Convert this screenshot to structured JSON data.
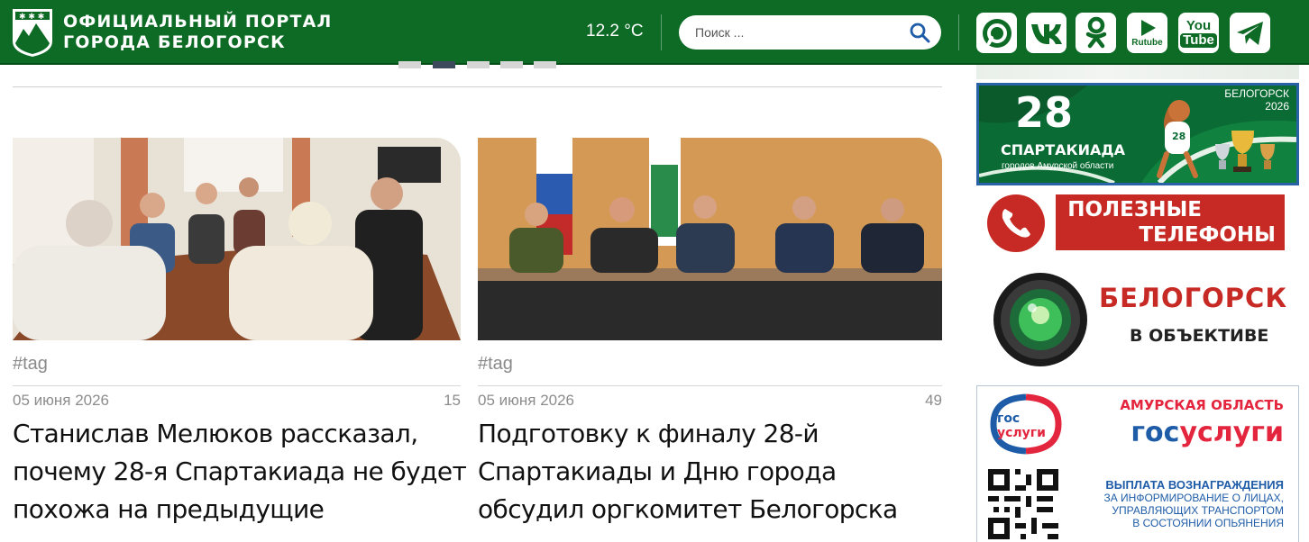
{
  "header": {
    "site_title_line1": "ОФИЦИАЛЬНЫЙ ПОРТАЛ",
    "site_title_line2": "ГОРОДА БЕЛОГОРСК",
    "temperature": "12.2 °C",
    "search_placeholder": "Поиск ...",
    "social": [
      {
        "name": "max",
        "icon": "max-icon"
      },
      {
        "name": "vk",
        "label": "VK",
        "icon": "vk-icon"
      },
      {
        "name": "odnoklassniki",
        "icon": "ok-icon"
      },
      {
        "name": "rutube",
        "label": "Rutube",
        "icon": "rutube-icon"
      },
      {
        "name": "youtube",
        "label_top": "You",
        "label_bottom": "Tube",
        "icon": "youtube-icon"
      },
      {
        "name": "telegram",
        "icon": "telegram-icon"
      }
    ]
  },
  "slider": {
    "dots": 5,
    "active_index": 1
  },
  "news": [
    {
      "tag": "#tag",
      "date": "05 июня 2026",
      "views": "15",
      "title": "Станислав Мелюков рассказал, почему 28-я Спартакиада не будет похожа на предыдущие"
    },
    {
      "tag": "#tag",
      "date": "05 июня 2026",
      "views": "49",
      "title": "Подготовку к финалу 28-й Спартакиады и Дню города обсудил оргкомитет Белогорска"
    }
  ],
  "sidebar": {
    "spartakiad": {
      "number": "28",
      "name": "СПАРТАКИАДА",
      "subtitle": "городов Амурской области",
      "city": "БЕЛОГОРСК",
      "year": "2026",
      "mascot_number": "28"
    },
    "phones": {
      "line1": "ПОЛЕЗНЫЕ",
      "line2": "ТЕЛЕФОНЫ"
    },
    "photo": {
      "line1": "БЕЛОГОРСК",
      "line2": "В ОБЪЕКТИВЕ"
    },
    "gosuslugi": {
      "logo_top": "гос",
      "logo_bottom": "услуги",
      "region": "АМУРСКАЯ ОБЛАСТЬ",
      "brand_part1": "гос",
      "brand_part2": "услуги",
      "heading": "ВЫПЛАТА ВОЗНАГРАЖДЕНИЯ",
      "line1": "ЗА ИНФОРМИРОВАНИЕ О ЛИЦАХ,",
      "line2": "УПРАВЛЯЮЩИХ ТРАНСПОРТОМ",
      "line3": "В СОСТОЯНИИ ОПЬЯНЕНИЯ"
    }
  },
  "colors": {
    "header_green": "#0d6b25",
    "banner_green": "#0b6b34",
    "phones_red": "#c72a24",
    "gos_blue": "#1e5ca8",
    "gos_red": "#e3263e",
    "active_dot": "#3d4a5c"
  }
}
